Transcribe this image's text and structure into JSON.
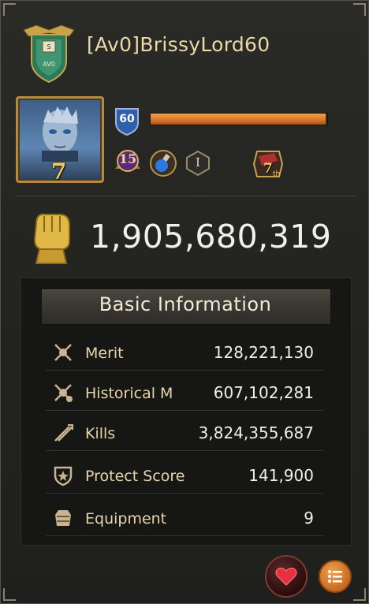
{
  "player": {
    "name": "[Av0]BrissyLord60",
    "alliance_emblem_text": "AV0",
    "avatar_level": "7",
    "level": "60",
    "xp_fraction": 0.99,
    "rank_badge": "15",
    "roman_badge": "I",
    "season_badge": "7",
    "season_suffix": "th"
  },
  "power": {
    "icon": "fist-icon",
    "value": "1,905,680,319"
  },
  "basic_info": {
    "title": "Basic Information",
    "rows": [
      {
        "icon": "merit-icon",
        "label": "Merit",
        "value": "128,221,130"
      },
      {
        "icon": "historical-merit-icon",
        "label": "Historical M",
        "value": "607,102,281"
      },
      {
        "icon": "kills-icon",
        "label": "Kills",
        "value": "3,824,355,687"
      },
      {
        "icon": "protect-score-icon",
        "label": "Protect Score",
        "value": "141,900"
      },
      {
        "icon": "equipment-icon",
        "label": "Equipment",
        "value": "9"
      }
    ]
  },
  "actions": {
    "like": "heart-icon",
    "menu": "list-icon"
  },
  "colors": {
    "accent_gold": "#ecd9a8",
    "xp_orange": "#d8762a",
    "panel_bg": "#232320"
  }
}
